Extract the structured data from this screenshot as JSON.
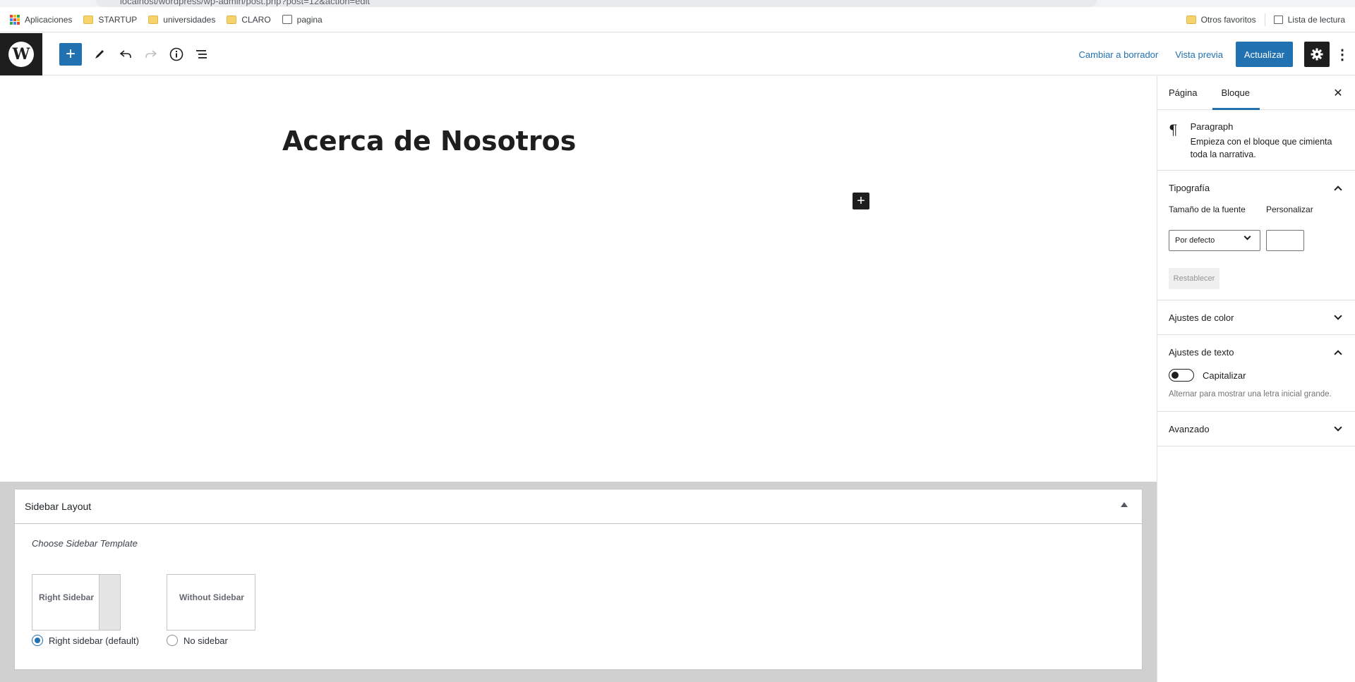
{
  "browser": {
    "url": "localhost/wordpress/wp-admin/post.php?post=12&action=edit",
    "bookmarks": [
      "Aplicaciones",
      "STARTUP",
      "universidades",
      "CLARO",
      "pagina"
    ],
    "right_bookmarks": [
      "Otros favoritos",
      "Lista de lectura"
    ]
  },
  "header": {
    "switch_to_draft": "Cambiar a borrador",
    "preview": "Vista previa",
    "update": "Actualizar"
  },
  "editor": {
    "title": "Acerca de Nosotros"
  },
  "sidebar": {
    "tabs": [
      "Página",
      "Bloque"
    ],
    "block": {
      "name": "Paragraph",
      "description": "Empieza con el bloque que cimienta toda la narrativa."
    },
    "typography": {
      "title": "Tipografía",
      "font_size_label": "Tamaño de la fuente",
      "custom_label": "Personalizar",
      "font_size_value": "Por defecto",
      "reset": "Restablecer"
    },
    "color_settings": "Ajustes de color",
    "text_settings": {
      "title": "Ajustes de texto",
      "drop_cap": "Capitalizar",
      "help": "Alternar para mostrar una letra inicial grande."
    },
    "advanced": "Avanzado"
  },
  "metabox": {
    "title": "Sidebar Layout",
    "choose": "Choose Sidebar Template",
    "options": [
      {
        "card": "Right Sidebar",
        "radio": "Right sidebar (default)",
        "selected": true
      },
      {
        "card": "Without Sidebar",
        "radio": "No sidebar",
        "selected": false
      }
    ]
  },
  "colors": {
    "accent": "#2271b1",
    "dark": "#1e1e1e"
  }
}
